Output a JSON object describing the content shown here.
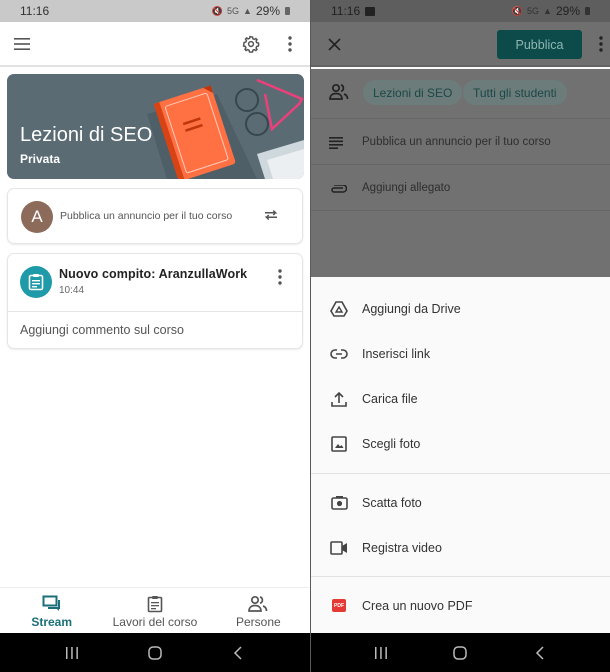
{
  "left": {
    "status": {
      "time": "11:16",
      "network": "5G",
      "battery": "29%"
    },
    "topbar": {
      "menu_icon": "hamburger-menu-icon",
      "settings_icon": "gear-icon",
      "more_icon": "more-vert-icon"
    },
    "banner": {
      "title": "Lezioni di SEO",
      "subtitle": "Privata"
    },
    "post_card": {
      "avatar_letter": "A",
      "placeholder": "Pubblica un annuncio per il tuo corso",
      "repost_icon": "repost-icon"
    },
    "task_card": {
      "title": "Nuovo compito: AranzullaWork",
      "time": "10:44",
      "comment_placeholder": "Aggiungi commento sul corso"
    },
    "bottom_nav": [
      {
        "label": "Stream",
        "icon": "stream-icon",
        "active": true
      },
      {
        "label": "Lavori del corso",
        "icon": "classwork-icon",
        "active": false
      },
      {
        "label": "Persone",
        "icon": "people-icon",
        "active": false
      }
    ]
  },
  "right": {
    "status": {
      "time": "11:16",
      "network": "5G",
      "battery": "29%"
    },
    "topbar": {
      "close_icon": "close-icon",
      "publish_label": "Pubblica",
      "more_icon": "more-vert-icon"
    },
    "audience": {
      "chips": [
        "Lezioni di SEO",
        "Tutti gli studenti"
      ]
    },
    "composer": {
      "placeholder": "Pubblica un annuncio per il tuo corso",
      "attach_label": "Aggiungi allegato"
    },
    "sheet": {
      "group1": [
        {
          "label": "Aggiungi da Drive",
          "icon": "drive-icon"
        },
        {
          "label": "Inserisci link",
          "icon": "link-icon"
        },
        {
          "label": "Carica file",
          "icon": "upload-icon"
        },
        {
          "label": "Scegli foto",
          "icon": "image-icon"
        }
      ],
      "group2": [
        {
          "label": "Scatta foto",
          "icon": "camera-icon"
        },
        {
          "label": "Registra video",
          "icon": "video-icon"
        }
      ],
      "group3": [
        {
          "label": "Crea un nuovo PDF",
          "icon": "pdf-icon",
          "icon_text": "PDF"
        }
      ]
    }
  },
  "colors": {
    "accent": "#1b6f79",
    "publish_bg": "#0d4b4a",
    "avatar": "#8d6b5b",
    "task_icon": "#1e9aa8",
    "banner": "#5a6b74"
  }
}
